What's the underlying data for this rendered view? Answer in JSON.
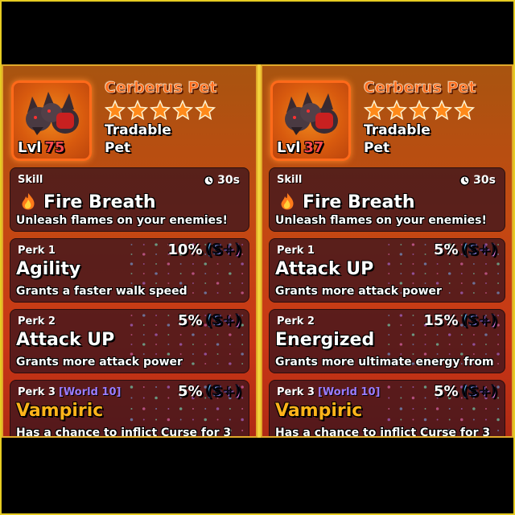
{
  "cards": [
    {
      "pet_name": "Cerberus Pet",
      "stars": 5,
      "level_label": "Lvl",
      "level": "75",
      "tradable": "Tradable",
      "type": "Pet",
      "skill": {
        "label": "Skill",
        "cooldown": "30s",
        "name": "Fire Breath",
        "desc": "Unleash flames on your enemies!"
      },
      "perks": [
        {
          "label": "Perk 1",
          "world": "",
          "percent": "10%",
          "grade": "(S+)",
          "name": "Agility",
          "desc": "Grants a faster walk speed"
        },
        {
          "label": "Perk 2",
          "world": "",
          "percent": "5%",
          "grade": "(S+)",
          "name": "Attack UP",
          "desc": "Grants more attack power"
        },
        {
          "label": "Perk 3",
          "world": "[World 10]",
          "percent": "5%",
          "grade": "(S+)",
          "name": "Vampiric",
          "desc": "Has a chance to inflict Curse for 3"
        }
      ]
    },
    {
      "pet_name": "Cerberus Pet",
      "stars": 5,
      "level_label": "Lvl",
      "level": "37",
      "tradable": "Tradable",
      "type": "Pet",
      "skill": {
        "label": "Skill",
        "cooldown": "30s",
        "name": "Fire Breath",
        "desc": "Unleash flames on your enemies!"
      },
      "perks": [
        {
          "label": "Perk 1",
          "world": "",
          "percent": "5%",
          "grade": "(S+)",
          "name": "Attack UP",
          "desc": "Grants more attack power"
        },
        {
          "label": "Perk 2",
          "world": "",
          "percent": "15%",
          "grade": "(S+)",
          "name": "Energized",
          "desc": "Grants more ultimate energy from"
        },
        {
          "label": "Perk 3",
          "world": "[World 10]",
          "percent": "5%",
          "grade": "(S+)",
          "name": "Vampiric",
          "desc": "Has a chance to inflict Curse for 3"
        }
      ]
    }
  ],
  "icons": {
    "star": "star-icon",
    "clock": "clock-icon",
    "flame": "flame-icon",
    "pet": "cerberus-pet-icon"
  },
  "colors": {
    "star": "#ff8a1a",
    "name": "#ff6a1a",
    "level": "#ff4a4a",
    "world": "#9a7cff",
    "perk3": "#ffb41a"
  }
}
